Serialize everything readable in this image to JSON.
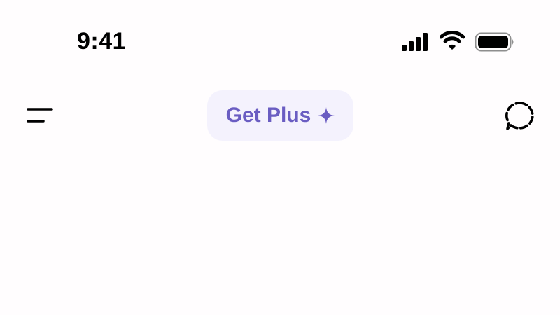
{
  "status_bar": {
    "time": "9:41",
    "icons": [
      "signal-icon",
      "wifi-icon",
      "battery-icon"
    ]
  },
  "header": {
    "menu_icon": "menu-icon",
    "get_plus_label": "Get Plus",
    "get_plus_icon": "sparkle-icon",
    "new_chat_icon": "new-chat-icon"
  },
  "colors": {
    "background": "#fffdfe",
    "accent": "#6a5dc2",
    "pill_background": "#f4f2fd",
    "icon": "#000000"
  }
}
